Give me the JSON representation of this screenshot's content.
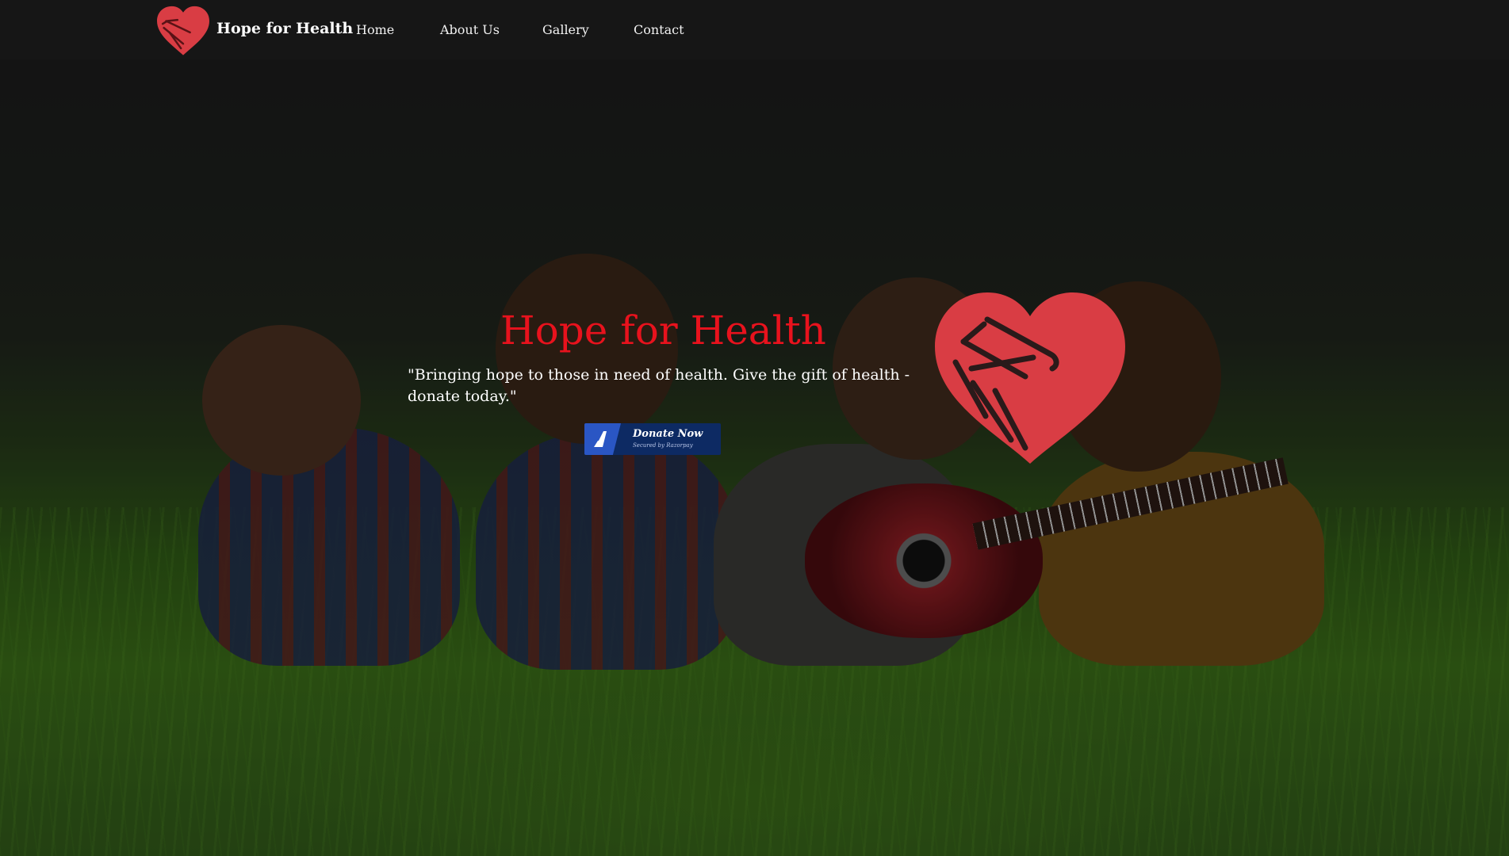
{
  "navbar": {
    "brand": "Hope for Health",
    "links": [
      "Home",
      "About Us",
      "Gallery",
      "Contact"
    ]
  },
  "hero": {
    "title": "Hope for Health",
    "quote": "\"Bringing hope to those in need of health. Give the gift of health - donate today.\"",
    "donate_button": {
      "label": "Donate Now",
      "sublabel": "Secured by Razorpay"
    }
  },
  "colors": {
    "accent_red": "#e8121d",
    "logo_red": "#d93d44",
    "navbar_bg": "#161616",
    "donate_bg": "#0d2a63",
    "donate_icon_bg": "#2a56c4"
  },
  "icons": {
    "logo": "handshake-heart-icon",
    "donate": "razorpay-icon"
  }
}
